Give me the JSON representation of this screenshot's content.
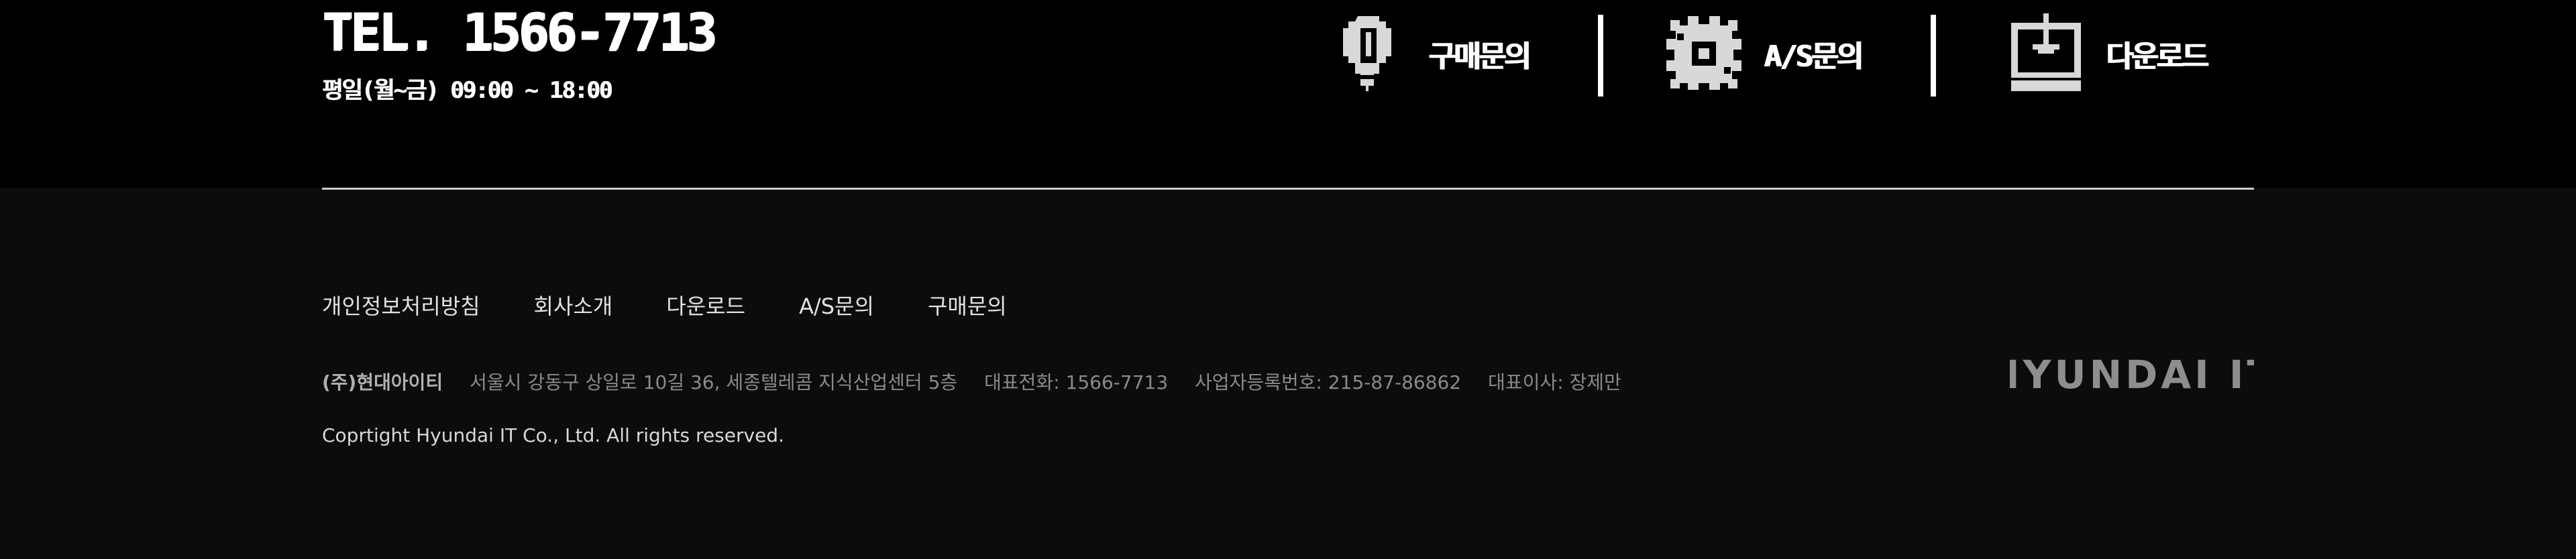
{
  "contact": {
    "tel": "TEL. 1566-7713",
    "hours": "평일(월~금) 09:00 ~ 18:00"
  },
  "quick_links": [
    {
      "label": "구매문의",
      "icon": "lightbulb-icon"
    },
    {
      "label": "A/S문의",
      "icon": "gear-icon"
    },
    {
      "label": "다운로드",
      "icon": "download-monitor-icon"
    }
  ],
  "footer": {
    "nav": [
      "개인정보처리방침",
      "회사소개",
      "다운로드",
      "A/S문의",
      "구매문의"
    ],
    "company_name": "(주)현대아이티",
    "address": "서울시 강동구 상일로 10길 36, 세종텔레콤 지식산업센터 5층",
    "phone": "대표전화: 1566-7713",
    "business_no": "사업자등록번호: 215-87-86862",
    "ceo": "대표이사: 장제만",
    "copyright": "Coprtight Hyundai IT Co., Ltd.  All rights reserved.",
    "logo_text": "HYUNDAI IT"
  },
  "colors": {
    "top_background": "#000000",
    "footer_background": "#0c0c0c",
    "logo": "#8e8e8e"
  }
}
